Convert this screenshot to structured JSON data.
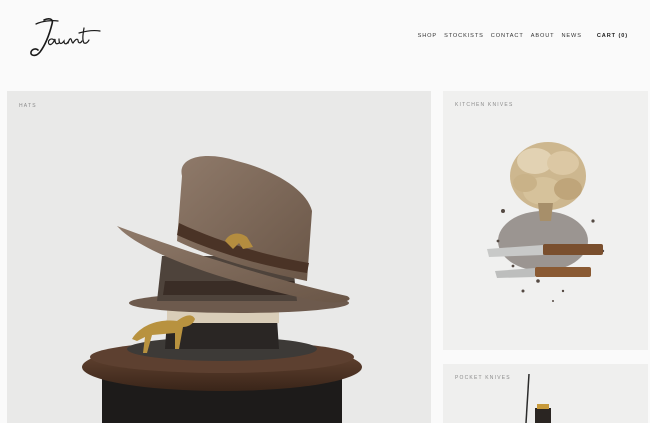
{
  "brand": {
    "logo_text": "Jaunt"
  },
  "nav": {
    "items": [
      {
        "label": "SHOP"
      },
      {
        "label": "STOCKISTS"
      },
      {
        "label": "CONTACT"
      },
      {
        "label": "ABOUT"
      },
      {
        "label": "NEWS"
      }
    ],
    "cart_label": "CART (0)"
  },
  "tiles": [
    {
      "label": "HATS"
    },
    {
      "label": "KITCHEN KNIVES"
    },
    {
      "label": "POCKET KNIVES"
    }
  ],
  "colors": {
    "background": "#fafafa",
    "tile_bg": "#e9e9e8",
    "text": "#333333",
    "label": "#8a8a8a"
  }
}
